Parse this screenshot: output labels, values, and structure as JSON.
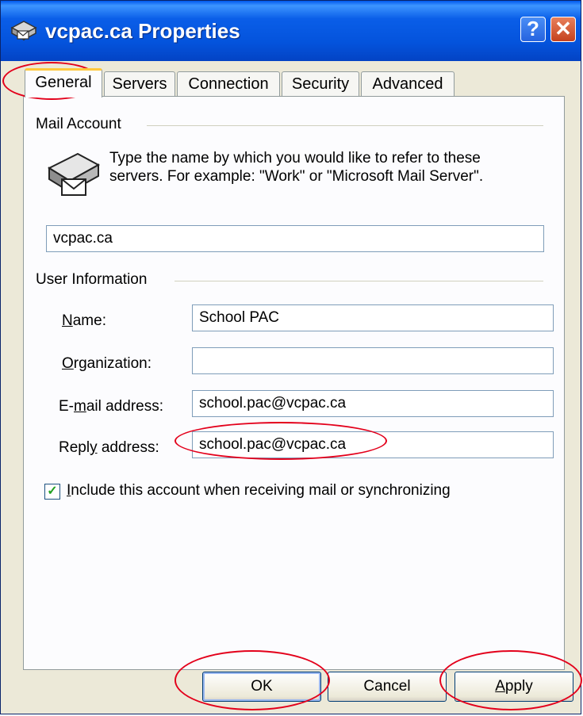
{
  "window": {
    "title": "vcpac.ca Properties",
    "help_glyph": "?",
    "close_glyph": "✕"
  },
  "tabs": [
    {
      "label": "General",
      "active": true
    },
    {
      "label": "Servers",
      "active": false
    },
    {
      "label": "Connection",
      "active": false
    },
    {
      "label": "Security",
      "active": false
    },
    {
      "label": "Advanced",
      "active": false
    }
  ],
  "mail_account": {
    "group_label": "Mail Account",
    "description": "Type the name by which you would like to refer to these servers.  For example: \"Work\" or \"Microsoft Mail Server\".",
    "account_name": "vcpac.ca"
  },
  "user_information": {
    "group_label": "User Information",
    "name": {
      "label_access_key": "N",
      "label_rest": "ame:",
      "value": "School PAC"
    },
    "organization": {
      "label_access_key": "O",
      "label_rest": "rganization:",
      "value": ""
    },
    "email": {
      "label_before": "E-",
      "label_access_key": "m",
      "label_rest": "ail address:",
      "value": "school.pac@vcpac.ca"
    },
    "reply": {
      "label_before": "Repl",
      "label_access_key": "y",
      "label_rest": " address:",
      "value": "school.pac@vcpac.ca"
    }
  },
  "include_account": {
    "checked": true,
    "check_glyph": "✓",
    "label_access_key": "I",
    "label_rest": "nclude this account when receiving mail or synchronizing"
  },
  "buttons": {
    "ok": "OK",
    "cancel": "Cancel",
    "apply_access_key": "A",
    "apply_rest": "pply"
  },
  "colors": {
    "titlebar": "#0453dc",
    "annotation": "#e3001b",
    "dialog_face": "#ece9d8"
  }
}
